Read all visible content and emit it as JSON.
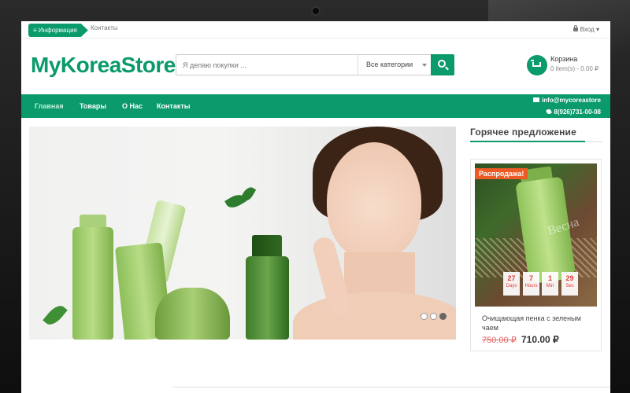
{
  "topbar": {
    "info_label": "≡ Информация",
    "contacts_label": "Контакты",
    "login_label": "Вход"
  },
  "header": {
    "logo": "MyKoreaStore",
    "search_placeholder": "Я делаю покупки ...",
    "category_selected": "Все категории",
    "cart_title": "Корзина",
    "cart_total": "0 item(s) - 0.00 ₽"
  },
  "nav": {
    "items": [
      "Главная",
      "Товары",
      "О Нас",
      "Контакты"
    ],
    "email": "info@mycoreastore",
    "phone": "8(926)731-00-08"
  },
  "hot_offer": {
    "title": "Горячее предложение",
    "sale_badge": "Распродажа!",
    "watermark": "Весна",
    "countdown": [
      {
        "value": "27",
        "unit": "Days"
      },
      {
        "value": "7",
        "unit": "Hours"
      },
      {
        "value": "1",
        "unit": "Min"
      },
      {
        "value": "29",
        "unit": "Sec"
      }
    ],
    "product_name": "Очищающая пенка с зеленым чаем",
    "old_price": "750.00 ₽",
    "new_price": "710.00 ₽"
  },
  "slider": {
    "dot_count": 3,
    "active_dot": 3
  },
  "colors": {
    "brand": "#0a9a6b",
    "sale": "#ee5a24",
    "countdown": "#e23b3b"
  }
}
